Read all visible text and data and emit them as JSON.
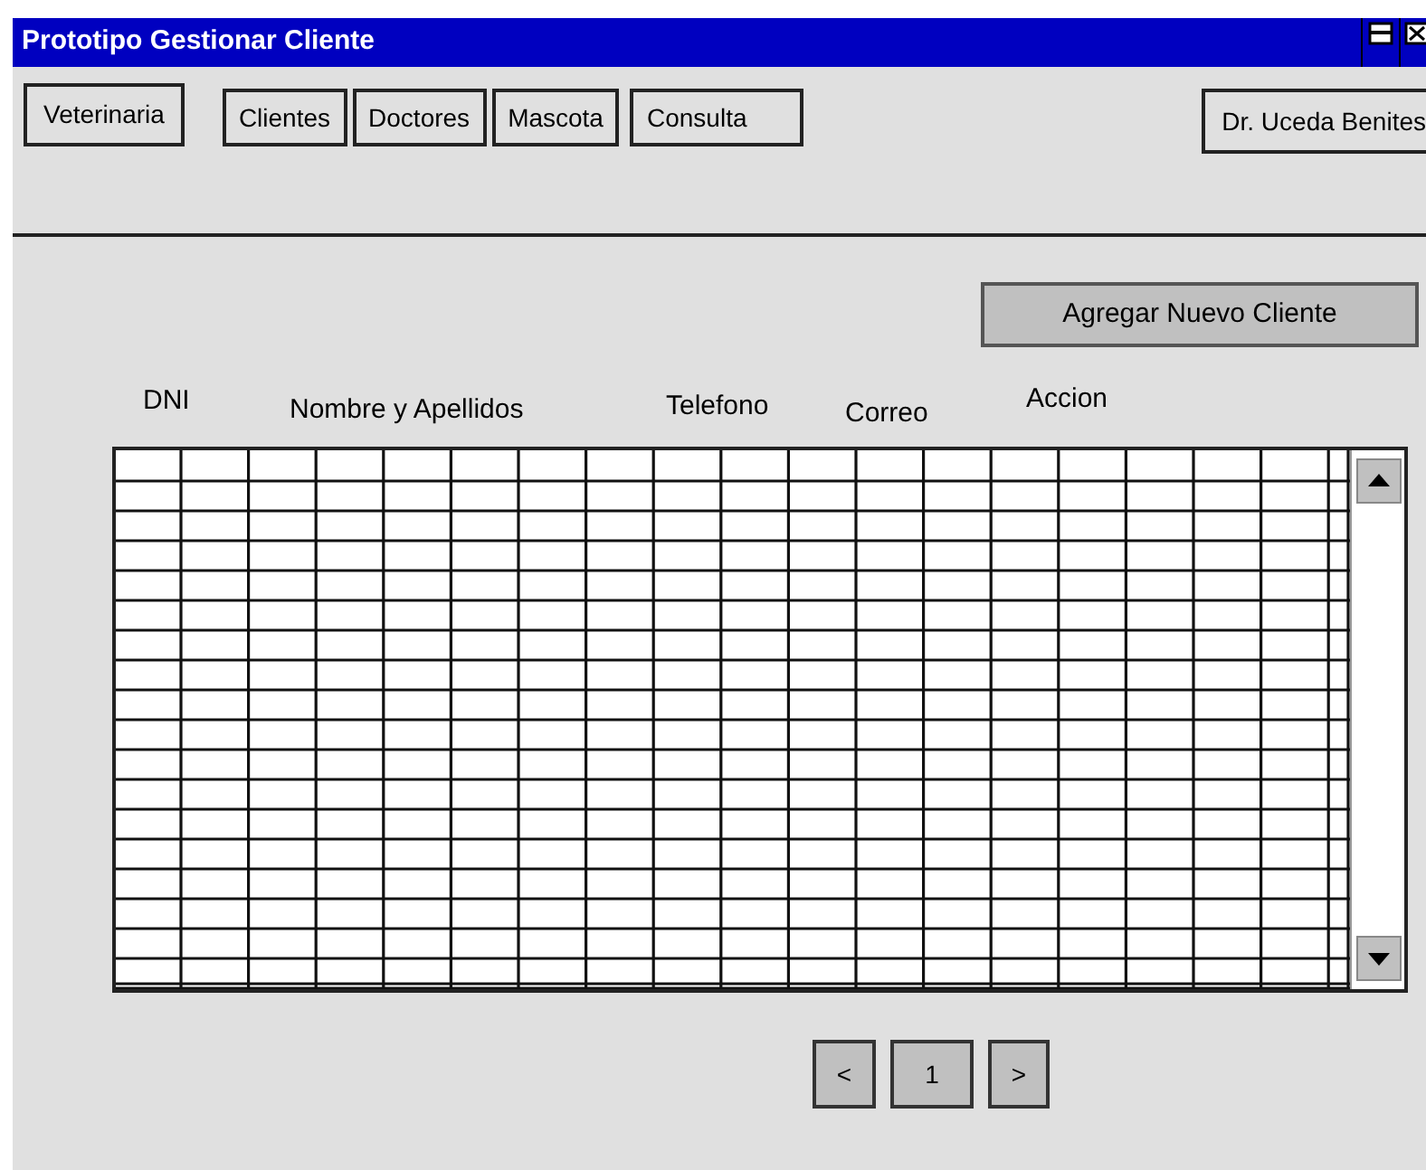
{
  "window": {
    "title": "Prototipo Gestionar Cliente"
  },
  "brand_button": "Veterinaria",
  "nav": [
    {
      "label": "Clientes"
    },
    {
      "label": "Doctores"
    },
    {
      "label": "Mascota"
    },
    {
      "label": "Consulta"
    }
  ],
  "user_button": "Dr. Uceda Benites",
  "add_button": "Agregar Nuevo Cliente",
  "table": {
    "columns": [
      "DNI",
      "Nombre y Apellidos",
      "Telefono",
      "Correo",
      "Accion"
    ]
  },
  "pagination": {
    "previous": "<",
    "pages": [
      {
        "label": "1"
      }
    ],
    "next": ">"
  }
}
